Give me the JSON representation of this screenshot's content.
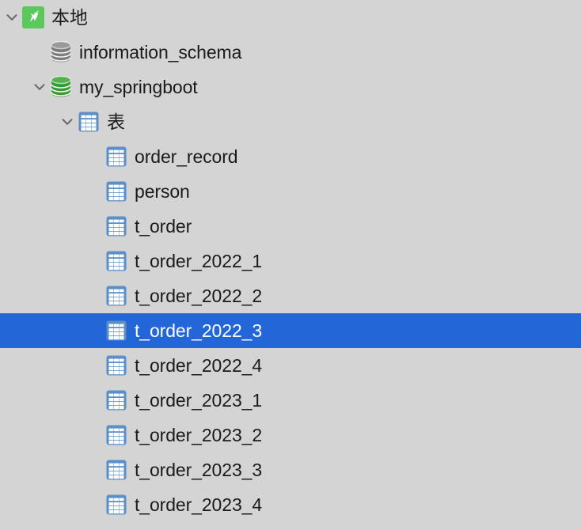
{
  "theme": {
    "background": "#d4d4d4",
    "selection_background": "#2266d8",
    "selection_text": "#ffffff",
    "text": "#1a1a1a",
    "mysql_green": "#5cc85c",
    "db_green": "#3a9b35",
    "db_gray": "#7d7d7d",
    "table_blue": "#5b8fc9"
  },
  "tree": {
    "nodes": [
      {
        "label": "本地",
        "icon": "mysql-dolphin-icon",
        "depth": 0,
        "expanded": true,
        "has_chevron": true,
        "selected": false
      },
      {
        "label": "information_schema",
        "icon": "database-gray-icon",
        "depth": 1,
        "expanded": false,
        "has_chevron": false,
        "selected": false
      },
      {
        "label": "my_springboot",
        "icon": "database-green-icon",
        "depth": 1,
        "expanded": true,
        "has_chevron": true,
        "selected": false
      },
      {
        "label": "表",
        "icon": "table-folder-icon",
        "depth": 2,
        "expanded": true,
        "has_chevron": true,
        "selected": false
      },
      {
        "label": "order_record",
        "icon": "table-icon",
        "depth": 3,
        "expanded": false,
        "has_chevron": false,
        "selected": false
      },
      {
        "label": "person",
        "icon": "table-icon",
        "depth": 3,
        "expanded": false,
        "has_chevron": false,
        "selected": false
      },
      {
        "label": "t_order",
        "icon": "table-icon",
        "depth": 3,
        "expanded": false,
        "has_chevron": false,
        "selected": false
      },
      {
        "label": "t_order_2022_1",
        "icon": "table-icon",
        "depth": 3,
        "expanded": false,
        "has_chevron": false,
        "selected": false
      },
      {
        "label": "t_order_2022_2",
        "icon": "table-icon",
        "depth": 3,
        "expanded": false,
        "has_chevron": false,
        "selected": false
      },
      {
        "label": "t_order_2022_3",
        "icon": "table-icon",
        "depth": 3,
        "expanded": false,
        "has_chevron": false,
        "selected": true
      },
      {
        "label": "t_order_2022_4",
        "icon": "table-icon",
        "depth": 3,
        "expanded": false,
        "has_chevron": false,
        "selected": false
      },
      {
        "label": "t_order_2023_1",
        "icon": "table-icon",
        "depth": 3,
        "expanded": false,
        "has_chevron": false,
        "selected": false
      },
      {
        "label": "t_order_2023_2",
        "icon": "table-icon",
        "depth": 3,
        "expanded": false,
        "has_chevron": false,
        "selected": false
      },
      {
        "label": "t_order_2023_3",
        "icon": "table-icon",
        "depth": 3,
        "expanded": false,
        "has_chevron": false,
        "selected": false
      },
      {
        "label": "t_order_2023_4",
        "icon": "table-icon",
        "depth": 3,
        "expanded": false,
        "has_chevron": false,
        "selected": false
      }
    ]
  }
}
